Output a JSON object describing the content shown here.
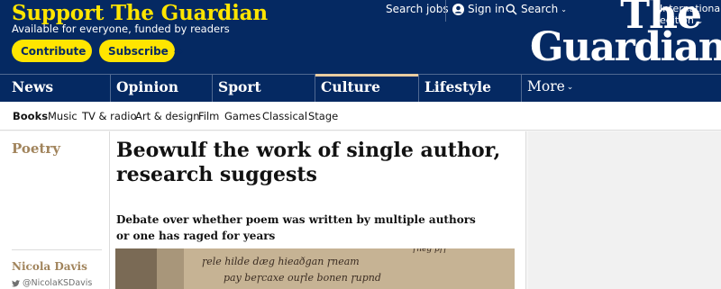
{
  "support": {
    "title": "Support The Guardian",
    "subtitle": "Available for everyone, funded by readers",
    "contribute_label": "Contribute",
    "subscribe_label": "Subscribe",
    "arrow": "→"
  },
  "topbar": {
    "jobs_label": "Search jobs",
    "signin_label": "Sign in",
    "search_label": "Search",
    "edition_line1": "International",
    "edition_line2": "edition",
    "chevron": "⌄"
  },
  "logo": {
    "line1": "The",
    "line2": "Guardian"
  },
  "pillars": [
    {
      "label": "News"
    },
    {
      "label": "Opinion"
    },
    {
      "label": "Sport"
    },
    {
      "label": "Culture"
    },
    {
      "label": "Lifestyle"
    },
    {
      "label": "More"
    }
  ],
  "subnav": [
    {
      "label": "Books"
    },
    {
      "label": "Music"
    },
    {
      "label": "TV & radio"
    },
    {
      "label": "Art & design"
    },
    {
      "label": "Film"
    },
    {
      "label": "Games"
    },
    {
      "label": "Classical"
    },
    {
      "label": "Stage"
    }
  ],
  "article": {
    "kicker": "Poetry",
    "headline": "Beowulf the work of single author, research suggests",
    "standfirst": "Debate over whether poem was written by multiple authors or one has raged for years",
    "byline": "Nicola Davis",
    "twitter_handle": "@NicolaKSDavis"
  },
  "colors": {
    "brand_blue": "#052962",
    "support_yellow": "#ffe500",
    "culture_accent": "#a1845c",
    "culture_bar": "#eacca0"
  },
  "icons": {
    "signin": "user-icon",
    "search": "search-icon",
    "twitter": "twitter-icon"
  }
}
